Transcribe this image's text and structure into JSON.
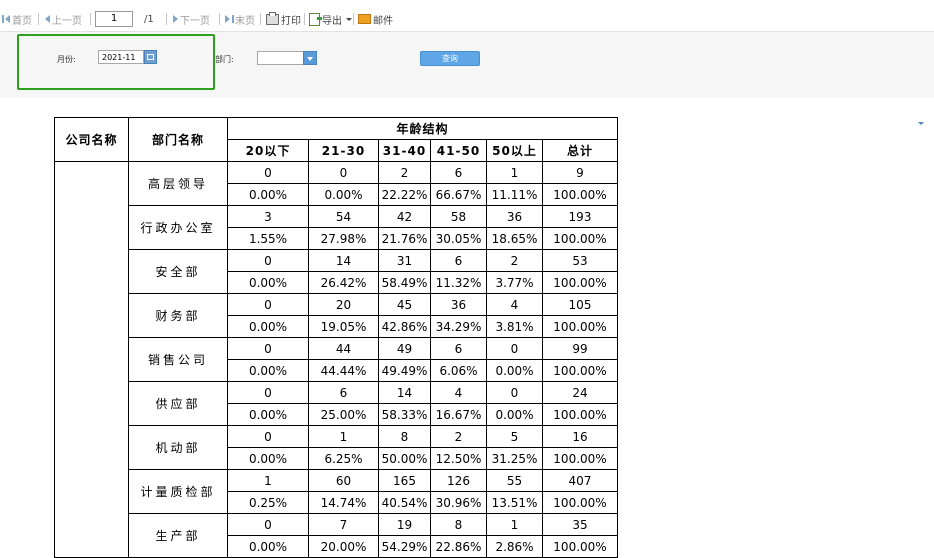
{
  "toolbar": {
    "first": "首页",
    "prev": "上一页",
    "page_value": "1",
    "page_total": "/1",
    "next": "下一页",
    "last": "末页",
    "print": "打印",
    "export": "导出",
    "mail": "邮件"
  },
  "filter": {
    "month_label": "月份:",
    "month_value": "2021-11",
    "dept_label": "部门:",
    "dept_value": "",
    "query_button": "查询"
  },
  "report": {
    "col_company": "公司名称",
    "col_dept": "部门名称",
    "group_header": "年龄结构",
    "age_columns": [
      "20以下",
      "21-30",
      "31-40",
      "41-50",
      "50以上",
      "总计"
    ],
    "rows": [
      {
        "dept": "高层领导",
        "counts": [
          "0",
          "0",
          "2",
          "6",
          "1",
          "9"
        ],
        "percents": [
          "0.00%",
          "0.00%",
          "22.22%",
          "66.67%",
          "11.11%",
          "100.00%"
        ]
      },
      {
        "dept": "行政办公室",
        "counts": [
          "3",
          "54",
          "42",
          "58",
          "36",
          "193"
        ],
        "percents": [
          "1.55%",
          "27.98%",
          "21.76%",
          "30.05%",
          "18.65%",
          "100.00%"
        ]
      },
      {
        "dept": "安全部",
        "counts": [
          "0",
          "14",
          "31",
          "6",
          "2",
          "53"
        ],
        "percents": [
          "0.00%",
          "26.42%",
          "58.49%",
          "11.32%",
          "3.77%",
          "100.00%"
        ]
      },
      {
        "dept": "财务部",
        "counts": [
          "0",
          "20",
          "45",
          "36",
          "4",
          "105"
        ],
        "percents": [
          "0.00%",
          "19.05%",
          "42.86%",
          "34.29%",
          "3.81%",
          "100.00%"
        ]
      },
      {
        "dept": "销售公司",
        "counts": [
          "0",
          "44",
          "49",
          "6",
          "0",
          "99"
        ],
        "percents": [
          "0.00%",
          "44.44%",
          "49.49%",
          "6.06%",
          "0.00%",
          "100.00%"
        ]
      },
      {
        "dept": "供应部",
        "counts": [
          "0",
          "6",
          "14",
          "4",
          "0",
          "24"
        ],
        "percents": [
          "0.00%",
          "25.00%",
          "58.33%",
          "16.67%",
          "0.00%",
          "100.00%"
        ]
      },
      {
        "dept": "机动部",
        "counts": [
          "0",
          "1",
          "8",
          "2",
          "5",
          "16"
        ],
        "percents": [
          "0.00%",
          "6.25%",
          "50.00%",
          "12.50%",
          "31.25%",
          "100.00%"
        ]
      },
      {
        "dept": "计量质检部",
        "counts": [
          "1",
          "60",
          "165",
          "126",
          "55",
          "407"
        ],
        "percents": [
          "0.25%",
          "14.74%",
          "40.54%",
          "30.96%",
          "13.51%",
          "100.00%"
        ]
      },
      {
        "dept": "生产部",
        "counts": [
          "0",
          "7",
          "19",
          "8",
          "1",
          "35"
        ],
        "percents": [
          "0.00%",
          "20.00%",
          "54.29%",
          "22.86%",
          "2.86%",
          "100.00%"
        ]
      }
    ]
  }
}
